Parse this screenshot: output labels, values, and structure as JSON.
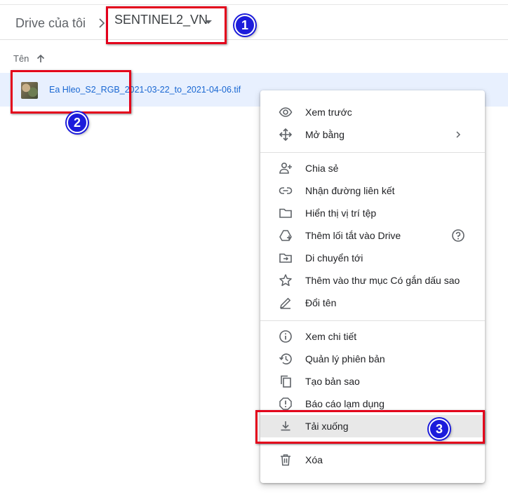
{
  "breadcrumb": {
    "root": "Drive của tôi",
    "current": "SENTINEL2_VN"
  },
  "list": {
    "column_header": "Tên",
    "sort": "ascending"
  },
  "file": {
    "name": "Ea Hleo_S2_RGB_2021-03-22_to_2021-04-06.tif"
  },
  "context_menu": {
    "items": [
      {
        "label": "Xem trước",
        "icon": "eye-icon"
      },
      {
        "label": "Mở bằng",
        "icon": "open-with-icon"
      },
      {
        "label": "Chia sẻ",
        "icon": "person-add-icon"
      },
      {
        "label": "Nhận đường liên kết",
        "icon": "link-icon"
      },
      {
        "label": "Hiển thị vị trí tệp",
        "icon": "folder-icon"
      },
      {
        "label": "Thêm lối tắt vào Drive",
        "icon": "add-shortcut-icon"
      },
      {
        "label": "Di chuyển tới",
        "icon": "move-to-folder-icon"
      },
      {
        "label": "Thêm vào thư mục Có gắn dấu sao",
        "icon": "star-icon"
      },
      {
        "label": "Đổi tên",
        "icon": "pencil-icon"
      },
      {
        "label": "Xem chi tiết",
        "icon": "info-icon"
      },
      {
        "label": "Quản lý phiên bản",
        "icon": "history-icon"
      },
      {
        "label": "Tạo bản sao",
        "icon": "copy-icon"
      },
      {
        "label": "Báo cáo lạm dụng",
        "icon": "report-icon"
      },
      {
        "label": "Tải xuống",
        "icon": "download-icon"
      },
      {
        "label": "Xóa",
        "icon": "trash-icon"
      }
    ]
  },
  "annotations": {
    "marker1": "1",
    "marker2": "2",
    "marker3": "3",
    "box_color": "#e3001b",
    "marker_color": "#1c1cdb"
  },
  "colors": {
    "selected_row": "#e8f0fe",
    "file_link": "#1967d2"
  }
}
